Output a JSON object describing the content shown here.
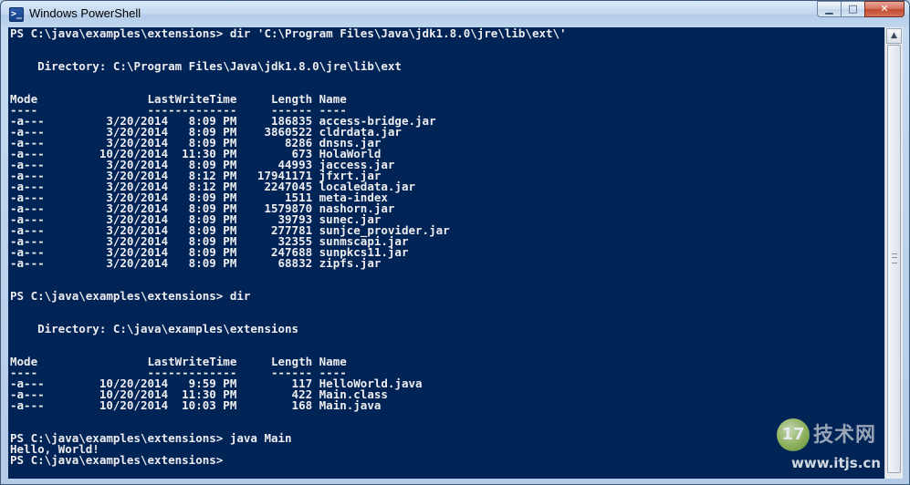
{
  "window": {
    "title": "Windows PowerShell",
    "icon": "powershell-icon",
    "icon_glyph": ">_",
    "controls": {
      "minimize_glyph": "▁",
      "maximize_glyph": "□",
      "close_glyph": "✕"
    }
  },
  "console": {
    "background": "#012456",
    "foreground": "#eeedf0",
    "lines": [
      "PS C:\\java\\examples\\extensions> dir 'C:\\Program Files\\Java\\jdk1.8.0\\jre\\lib\\ext\\'",
      "",
      "",
      "    Directory: C:\\Program Files\\Java\\jdk1.8.0\\jre\\lib\\ext",
      "",
      "",
      "Mode                LastWriteTime     Length Name",
      "----                -------------     ------ ----",
      "-a---         3/20/2014   8:09 PM     186835 access-bridge.jar",
      "-a---         3/20/2014   8:09 PM    3860522 cldrdata.jar",
      "-a---         3/20/2014   8:09 PM       8286 dnsns.jar",
      "-a---        10/20/2014  11:30 PM        673 HolaWorld",
      "-a---         3/20/2014   8:09 PM      44993 jaccess.jar",
      "-a---         3/20/2014   8:12 PM   17941171 jfxrt.jar",
      "-a---         3/20/2014   8:12 PM    2247045 localedata.jar",
      "-a---         3/20/2014   8:09 PM       1511 meta-index",
      "-a---         3/20/2014   8:09 PM    1579870 nashorn.jar",
      "-a---         3/20/2014   8:09 PM      39793 sunec.jar",
      "-a---         3/20/2014   8:09 PM     277781 sunjce_provider.jar",
      "-a---         3/20/2014   8:09 PM      32355 sunmscapi.jar",
      "-a---         3/20/2014   8:09 PM     247688 sunpkcs11.jar",
      "-a---         3/20/2014   8:09 PM      68832 zipfs.jar",
      "",
      "",
      "PS C:\\java\\examples\\extensions> dir",
      "",
      "",
      "    Directory: C:\\java\\examples\\extensions",
      "",
      "",
      "Mode                LastWriteTime     Length Name",
      "----                -------------     ------ ----",
      "-a---        10/20/2014   9:59 PM        117 HelloWorld.java",
      "-a---        10/20/2014  11:30 PM        422 Main.class",
      "-a---        10/20/2014  10:03 PM        168 Main.java",
      "",
      "",
      "PS C:\\java\\examples\\extensions> java Main",
      "Hello, World!",
      "PS C:\\java\\examples\\extensions>"
    ]
  },
  "scrollbar": {
    "up_arrow_glyph": "▲"
  },
  "watermark": {
    "logo_text": "17",
    "title": "技术网",
    "url": "www.itjs.cn"
  }
}
